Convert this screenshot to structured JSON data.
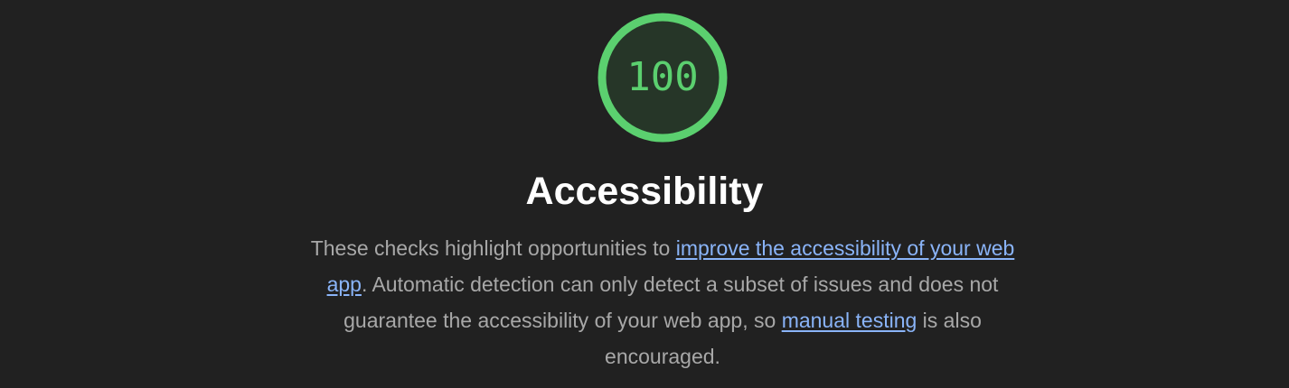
{
  "category": {
    "score": "100",
    "score_value": 100,
    "gauge_color": "#5bd06f",
    "gauge_fill": "#263628",
    "title": "Accessibility",
    "description": {
      "text1": "These checks highlight opportunities to ",
      "link1": "improve the accessibility of your web app",
      "text2": ". Automatic detection can only detect a subset of issues and does not guarantee the accessibility of your web app, so ",
      "link2": "manual testing",
      "text3": " is also encouraged."
    }
  },
  "colors": {
    "background": "#212121",
    "title": "#ffffff",
    "body_text": "#a8a8a8",
    "link": "#8ab4f8"
  }
}
